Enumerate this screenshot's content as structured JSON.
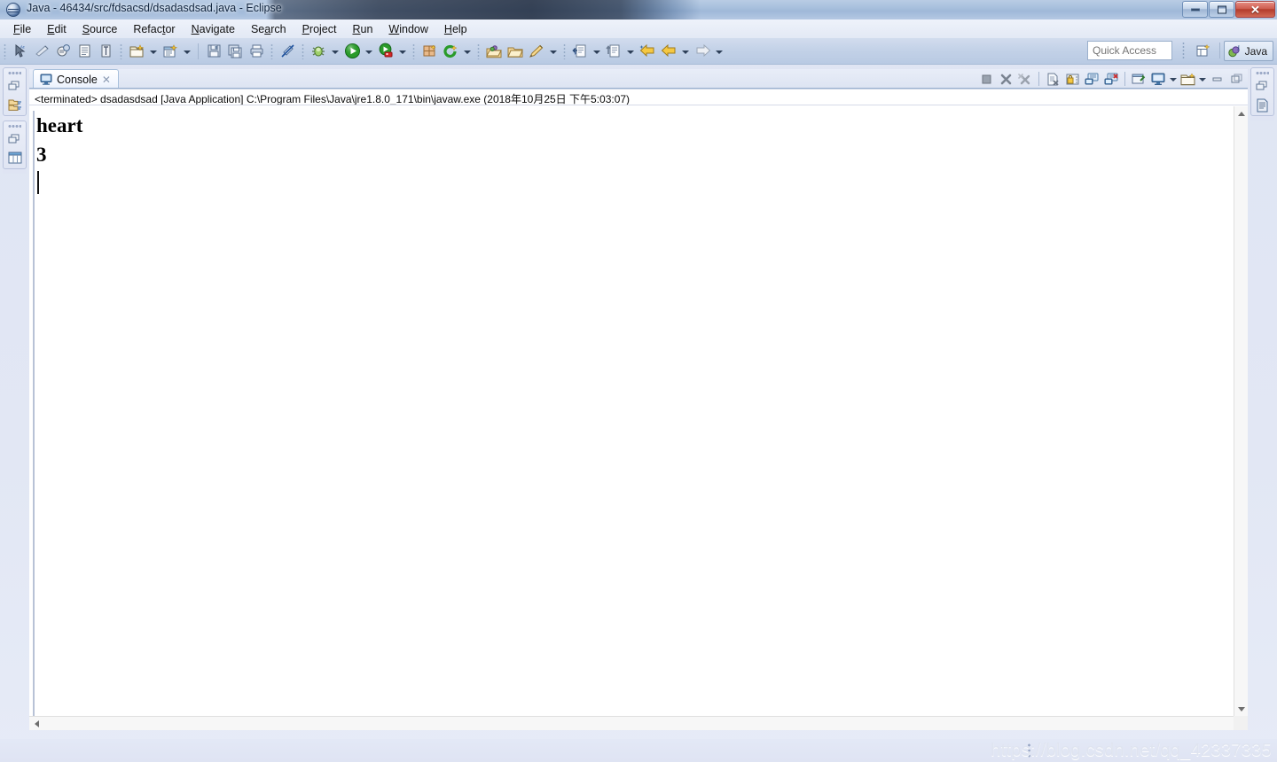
{
  "window": {
    "title": "Java - 46434/src/fdsacsd/dsadasdsad.java - Eclipse",
    "app_icon": "eclipse-icon",
    "minimize_label": "",
    "maximize_label": "",
    "close_label": "✕"
  },
  "menubar": {
    "items": [
      {
        "label": "File",
        "mnemonic": "F"
      },
      {
        "label": "Edit",
        "mnemonic": "E"
      },
      {
        "label": "Source",
        "mnemonic": "S"
      },
      {
        "label": "Refactor",
        "mnemonic": "t"
      },
      {
        "label": "Navigate",
        "mnemonic": "N"
      },
      {
        "label": "Search",
        "mnemonic": "a"
      },
      {
        "label": "Project",
        "mnemonic": "P"
      },
      {
        "label": "Run",
        "mnemonic": "R"
      },
      {
        "label": "Window",
        "mnemonic": "W"
      },
      {
        "label": "Help",
        "mnemonic": "H"
      }
    ]
  },
  "toolbar": {
    "buttons": [
      {
        "name": "toggle-mark-occurrences-icon",
        "tooltip": "Toggle Mark Occurrences"
      },
      {
        "name": "skip-all-breakpoints-icon",
        "tooltip": "Skip All Breakpoints"
      },
      {
        "name": "new-java-class-icon",
        "tooltip": "New Java Class"
      },
      {
        "name": "open-task-icon",
        "tooltip": "Open Task"
      },
      {
        "name": "toggle-block-selection-icon",
        "tooltip": "Toggle Block Selection"
      },
      {
        "name": "new-wizard-icon",
        "tooltip": "New"
      },
      {
        "name": "new-java-package-icon",
        "tooltip": "New Java Package"
      },
      {
        "name": "save-icon",
        "tooltip": "Save"
      },
      {
        "name": "save-all-icon",
        "tooltip": "Save All"
      },
      {
        "name": "print-icon",
        "tooltip": "Print"
      },
      {
        "name": "no-annotations-icon",
        "tooltip": "Toggle Annotations"
      },
      {
        "name": "debug-icon",
        "tooltip": "Debug"
      },
      {
        "name": "run-icon",
        "tooltip": "Run"
      },
      {
        "name": "run-external-tools-icon",
        "tooltip": "External Tools"
      },
      {
        "name": "new-java-project-icon",
        "tooltip": "New Java Project"
      },
      {
        "name": "coverage-icon",
        "tooltip": "Coverage"
      },
      {
        "name": "open-type-icon",
        "tooltip": "Open Type"
      },
      {
        "name": "open-task-folder-icon",
        "tooltip": "Open Task"
      },
      {
        "name": "pencil-edit-icon",
        "tooltip": "Edit"
      },
      {
        "name": "next-annotation-icon",
        "tooltip": "Next Annotation"
      },
      {
        "name": "previous-annotation-icon",
        "tooltip": "Previous Annotation"
      },
      {
        "name": "back-history-icon",
        "tooltip": "Back"
      },
      {
        "name": "forward-history-icon",
        "tooltip": "Forward"
      }
    ],
    "quick_access_placeholder": "Quick Access",
    "open_perspective_icon": "open-perspective-icon",
    "perspective": {
      "label": "Java",
      "icon": "java-perspective-icon"
    }
  },
  "left_fastview": {
    "groups": [
      {
        "name": "restore-group-1",
        "icons": [
          "restore-icon",
          "package-explorer-icon"
        ]
      },
      {
        "name": "restore-group-2",
        "icons": [
          "restore-icon",
          "outline-view-icon"
        ]
      }
    ]
  },
  "right_fastview": {
    "groups": [
      {
        "name": "restore-group-3",
        "icons": [
          "restore-icon",
          "task-list-icon"
        ]
      }
    ]
  },
  "console": {
    "tab": {
      "label": "Console",
      "icon": "console-monitor-icon",
      "close": "✕"
    },
    "view_toolbar": [
      {
        "name": "terminate-icon",
        "tooltip": "Terminate"
      },
      {
        "name": "remove-launch-icon",
        "tooltip": "Remove Launch"
      },
      {
        "name": "remove-all-terminated-icon",
        "tooltip": "Remove All Terminated Launches"
      },
      {
        "name": "clear-console-icon",
        "tooltip": "Clear Console"
      },
      {
        "name": "scroll-lock-icon",
        "tooltip": "Scroll Lock"
      },
      {
        "name": "show-console-on-output-icon",
        "tooltip": "Show Console When Standard Out Changes"
      },
      {
        "name": "show-console-on-error-icon",
        "tooltip": "Show Console When Standard Error Changes"
      },
      {
        "name": "pin-console-icon",
        "tooltip": "Pin Console"
      },
      {
        "name": "display-selected-console-icon",
        "tooltip": "Display Selected Console"
      },
      {
        "name": "open-console-icon",
        "tooltip": "Open Console"
      },
      {
        "name": "minimize-view-icon",
        "tooltip": "Minimize"
      },
      {
        "name": "maximize-view-icon",
        "tooltip": "Maximize"
      }
    ],
    "process_line": "<terminated> dsadasdsad [Java Application] C:\\Program Files\\Java\\jre1.8.0_171\\bin\\javaw.exe (2018年10月25日 下午5:03:07)",
    "output_lines": [
      "heart",
      "3"
    ]
  },
  "statusbar": {
    "watermark": "https://blog.csdn.net/qq_42337335"
  },
  "colors": {
    "titlebar_text": "#10243e",
    "toolbar_bg": "#c2d1e7",
    "close_button": "#b33c2c",
    "console_bg": "#ffffff",
    "accent": "#3a6ea5"
  }
}
